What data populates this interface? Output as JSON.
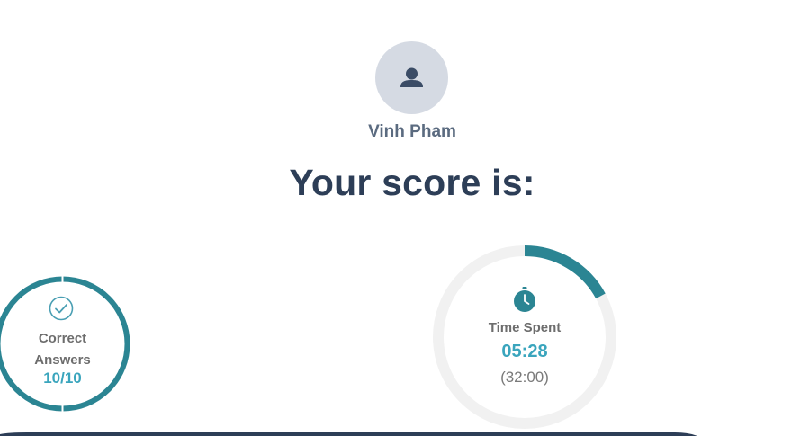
{
  "user": {
    "name": "Vinh Pham",
    "avatar_icon": "user-icon"
  },
  "heading": "Your score is:",
  "results": {
    "correct_answers": {
      "label": "Correct Answers",
      "value": "10/10",
      "fraction_correct": 1.0,
      "icon": "check-circle-icon"
    },
    "time_spent": {
      "label": "Time Spent",
      "value": "05:28",
      "limit": "(32:00)",
      "fraction_elapsed": 0.171,
      "icon": "stopwatch-icon"
    }
  },
  "colors": {
    "accent": "#2b8593",
    "value_text": "#3aa5bd",
    "ring_track": "#f1f1f1",
    "heading": "#2d3e57",
    "avatar_bg": "#d5dae3",
    "bottom_bar": "#2d3e57"
  }
}
